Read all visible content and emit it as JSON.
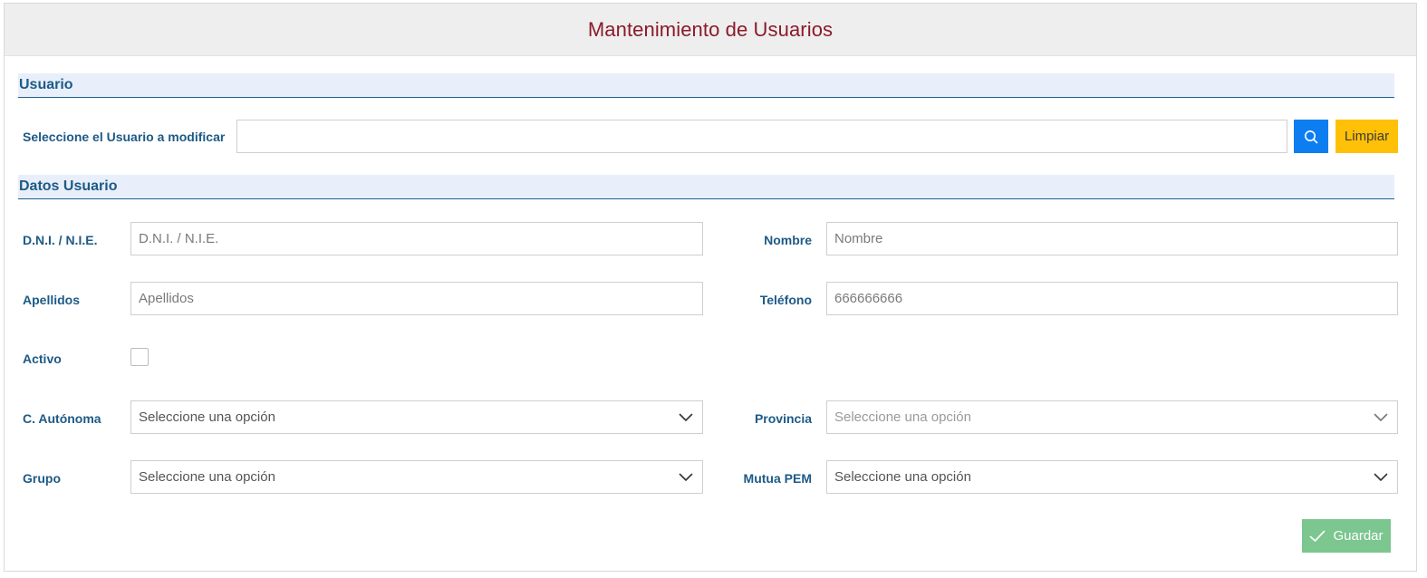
{
  "header": {
    "title": "Mantenimiento de Usuarios"
  },
  "section_user": {
    "title": "Usuario",
    "select_label": "Seleccione el Usuario a modificar",
    "select_value": "",
    "clear_label": "Limpiar"
  },
  "section_data": {
    "title": "Datos Usuario",
    "dni": {
      "label": "D.N.I. / N.I.E.",
      "placeholder": "D.N.I. / N.I.E.",
      "value": ""
    },
    "nombre": {
      "label": "Nombre",
      "placeholder": "Nombre",
      "value": ""
    },
    "apellidos": {
      "label": "Apellidos",
      "placeholder": "Apellidos",
      "value": ""
    },
    "telefono": {
      "label": "Teléfono",
      "placeholder": "666666666",
      "value": ""
    },
    "activo": {
      "label": "Activo",
      "checked": false
    },
    "autonoma": {
      "label": "C. Autónoma",
      "value": "Seleccione una opción"
    },
    "provincia": {
      "label": "Provincia",
      "value": "Seleccione una opción",
      "disabled": true
    },
    "grupo": {
      "label": "Grupo",
      "value": "Seleccione una opción"
    },
    "mutua": {
      "label": "Mutua PEM",
      "value": "Seleccione una opción"
    }
  },
  "actions": {
    "save_label": "Guardar"
  },
  "colors": {
    "title": "#8b1a2a",
    "label": "#1d5a86",
    "section_bg": "#e8effa",
    "search_button": "#0d7ef0",
    "clear_button": "#ffc107",
    "save_button": "#7cc68f"
  },
  "icons": {
    "search": "search-icon",
    "chevron": "chevron-down-icon",
    "save": "check-icon"
  }
}
